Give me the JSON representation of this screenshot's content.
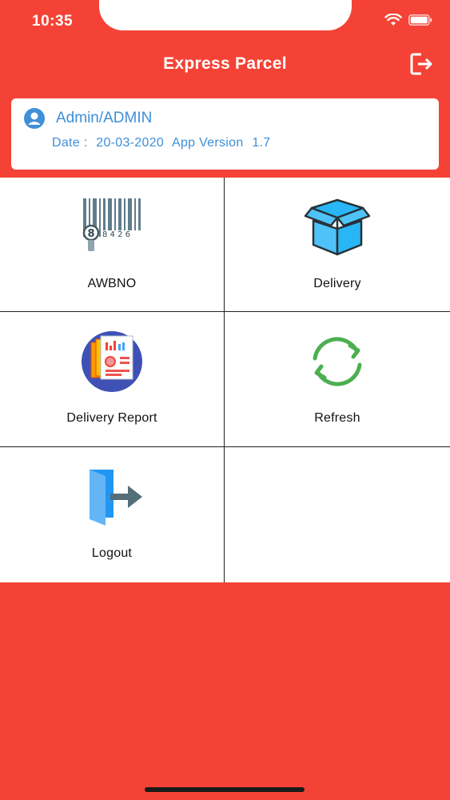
{
  "status": {
    "time": "10:35"
  },
  "header": {
    "title": "Express Parcel"
  },
  "info": {
    "user": "Admin/ADMIN",
    "date_label": "Date :",
    "date_value": "20-03-2020",
    "version_label": "App Version",
    "version_value": "1.7"
  },
  "menu": {
    "awbno": "AWBNO",
    "delivery": "Delivery",
    "delivery_report": "Delivery Report",
    "refresh": "Refresh",
    "logout": "Logout"
  },
  "colors": {
    "primary": "#f44336",
    "accent": "#3f8fd9",
    "background": "#ffffff"
  }
}
